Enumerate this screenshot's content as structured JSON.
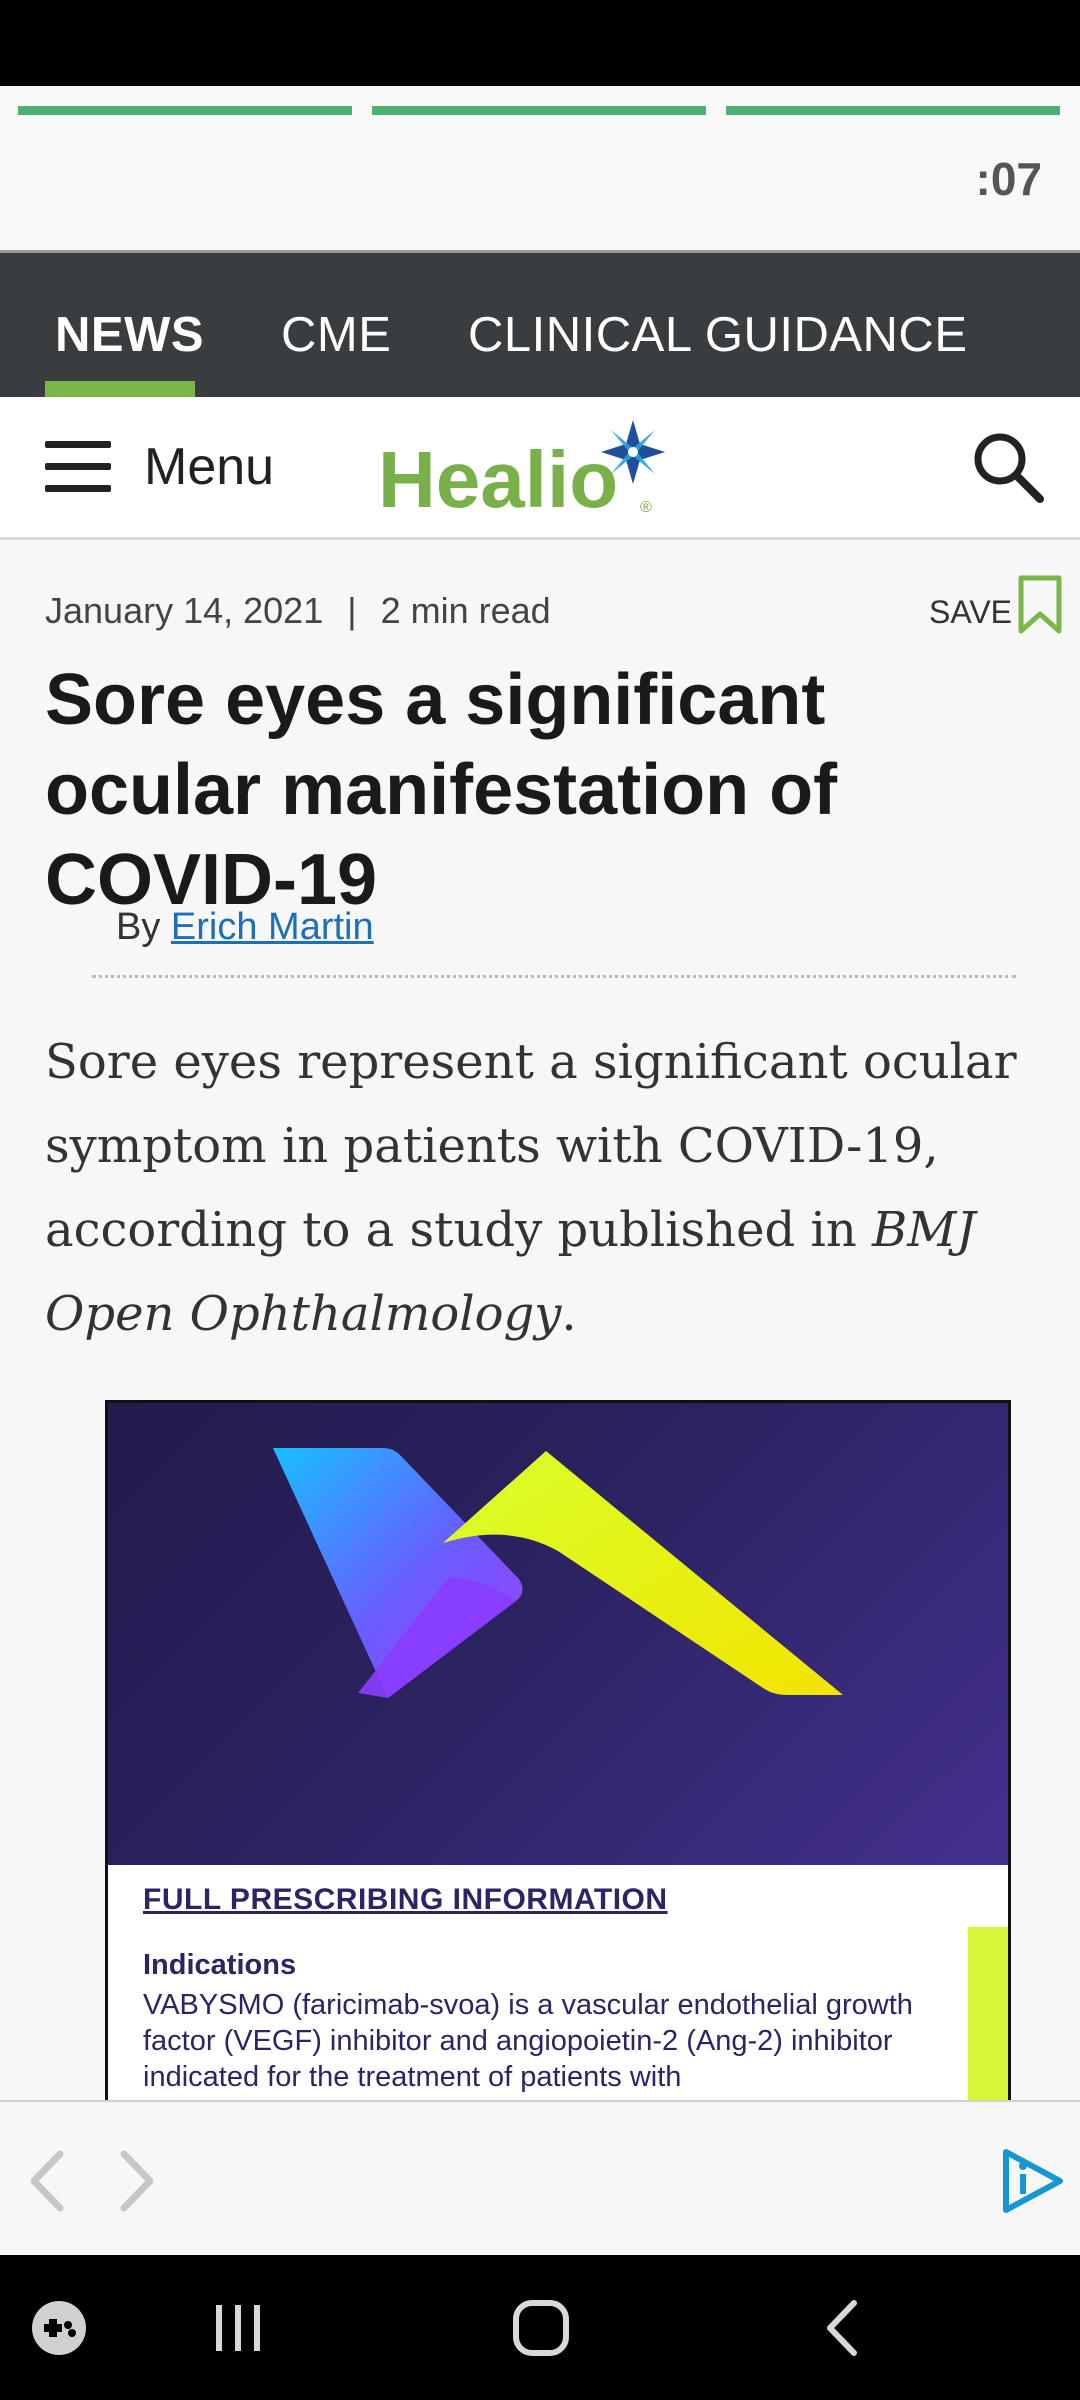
{
  "story": {
    "timer": ":07",
    "progress_segments": 3
  },
  "nav": {
    "tabs": [
      "NEWS",
      "CME",
      "CLINICAL GUIDANCE"
    ],
    "active": "NEWS"
  },
  "header": {
    "menu_label": "Menu",
    "logo_text": "Healio",
    "logo_mark": "®"
  },
  "article": {
    "date": "January 14, 2021",
    "separator": "|",
    "read_time": "2 min read",
    "save_label": "SAVE",
    "headline": "Sore eyes a significant ocular manifestation of COVID-19",
    "byline_prefix": "By",
    "author": "Erich Martin",
    "lead_text": "Sore eyes represent a significant ocular symptom in patients with COVID-19, according to a study published in",
    "lead_journal": "BMJ Open Ophthalmology",
    "lead_end": "."
  },
  "ad": {
    "heading": "FULL PRESCRIBING INFORMATION",
    "indications_title": "Indications",
    "indications_text": "VABYSMO (faricimab-svoa) is a vascular endothelial growth factor (VEGF) inhibitor and angiopoietin-2 (Ang-2) inhibitor indicated for the treatment of patients with"
  },
  "colors": {
    "accent_green": "#7ab648",
    "nav_bg": "#3a3d3f",
    "link_blue": "#1d6fb8",
    "ad_purple": "#2c2466"
  },
  "icons": [
    "menu-icon",
    "search-icon",
    "bookmark-icon",
    "back-arrow-icon",
    "forward-arrow-icon",
    "brand-icon",
    "gamepad-icon",
    "recents-icon",
    "home-icon",
    "back-icon"
  ]
}
